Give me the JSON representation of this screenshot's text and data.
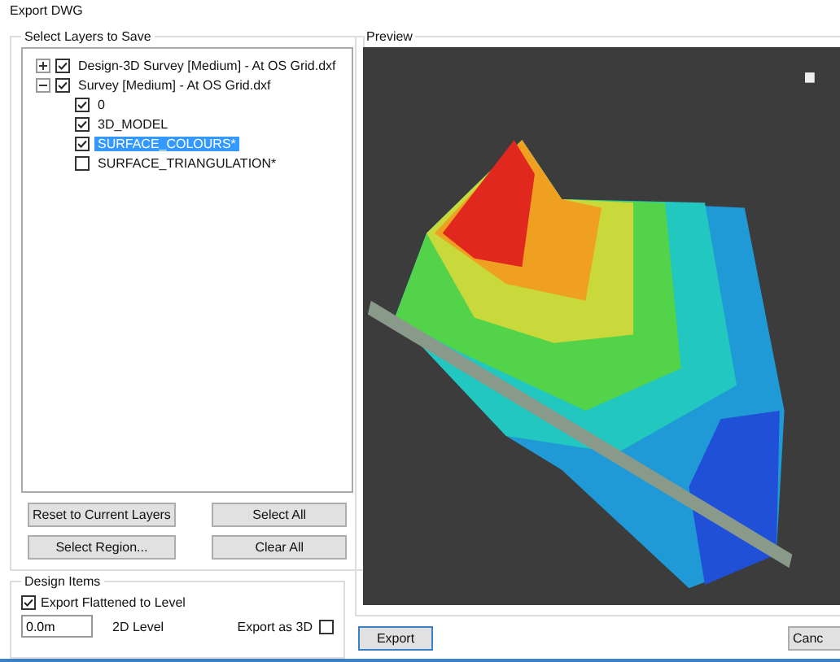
{
  "window": {
    "title": "Export DWG"
  },
  "layers": {
    "title": "Select Layers to Save",
    "tree": [
      {
        "label": "Design-3D Survey [Medium] - At OS Grid.dxf",
        "checked": true,
        "expanded": false,
        "selected": false
      },
      {
        "label": "Survey [Medium] - At OS Grid.dxf",
        "checked": true,
        "expanded": true,
        "selected": false,
        "children": [
          {
            "label": "0",
            "checked": true,
            "selected": false
          },
          {
            "label": "3D_MODEL",
            "checked": true,
            "selected": false
          },
          {
            "label": "SURFACE_COLOURS*",
            "checked": true,
            "selected": true
          },
          {
            "label": "SURFACE_TRIANGULATION*",
            "checked": false,
            "selected": false
          }
        ]
      }
    ],
    "buttons": [
      "Reset to Current Layers",
      "Select All",
      "Select Region...",
      "Clear All"
    ]
  },
  "design_items": {
    "title": "Design Items",
    "flatten": {
      "label": "Export Flattened to Level",
      "checked": true
    },
    "level": {
      "value": "0.0m",
      "label": "2D Level"
    },
    "export_3d": {
      "label": "Export as 3D",
      "checked": false
    }
  },
  "preview": {
    "title": "Preview"
  },
  "footer": {
    "buttons": [
      "Export",
      "Canc"
    ]
  }
}
